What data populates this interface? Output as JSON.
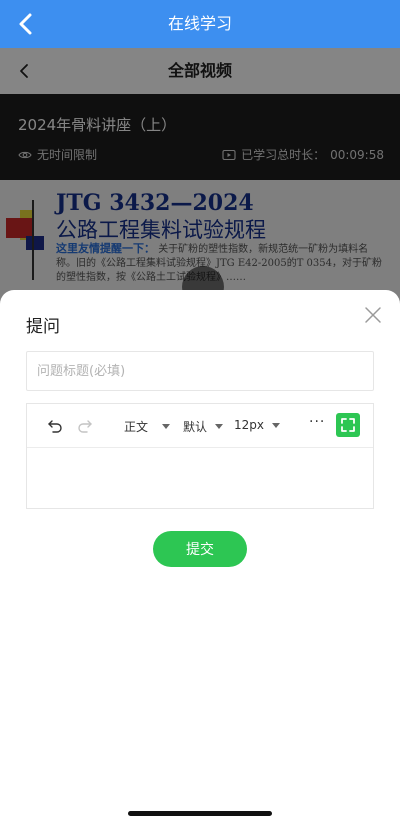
{
  "app_bar": {
    "title": "在线学习"
  },
  "sub_header": {
    "title": "全部视频"
  },
  "video": {
    "title": "2024年骨料讲座（上）",
    "time_limit": "无时间限制",
    "total_time_label": "已学习总时长：",
    "total_time_value": "00:09:58"
  },
  "slide_preview": {
    "line1": "JTG 3432—2024",
    "line2": "公路工程集料试验规程",
    "highlight": "这里友情提醒一下：",
    "body": "关于矿粉的塑性指数，新规范统一矿粉为填料名称。旧的《公路工程集料试验规程》JTG E42-2005的T 0354，对于矿粉的塑性指数，按《公路土工试验规程》……"
  },
  "question_sheet": {
    "title": "提问",
    "title_placeholder": "问题标题(必填)",
    "title_value": "",
    "toolbar": {
      "paragraph_style": "正文",
      "font_family": "默认",
      "font_size": "12px",
      "more": "···"
    },
    "submit_label": "提交"
  },
  "colors": {
    "app_bar": "#3d8ff0",
    "accent_green": "#2dc653",
    "video_bg": "#1d1d1d"
  }
}
